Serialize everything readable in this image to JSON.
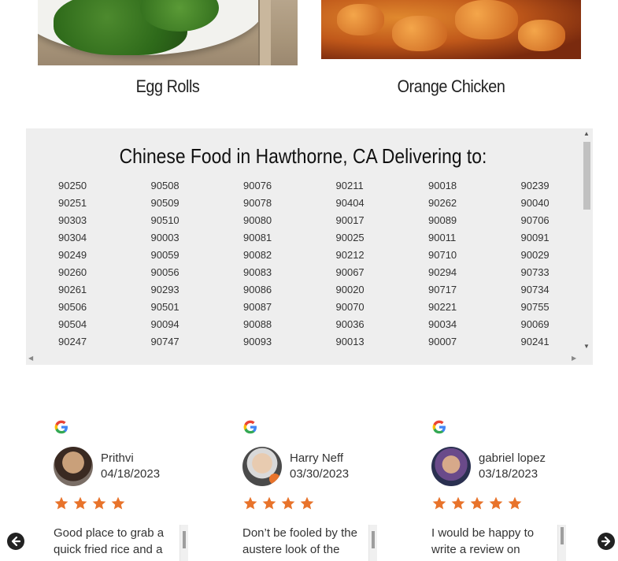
{
  "foods": [
    {
      "title": "Egg Rolls"
    },
    {
      "title": "Orange Chicken"
    }
  ],
  "delivery": {
    "heading": "Chinese Food in Hawthorne, CA Delivering to:",
    "zips": [
      "90250",
      "90508",
      "90076",
      "90211",
      "90018",
      "90239",
      "90251",
      "90509",
      "90078",
      "90404",
      "90262",
      "90040",
      "90303",
      "90510",
      "90080",
      "90017",
      "90089",
      "90706",
      "90304",
      "90003",
      "90081",
      "90025",
      "90011",
      "90091",
      "90249",
      "90059",
      "90082",
      "90212",
      "90710",
      "90029",
      "90260",
      "90056",
      "90083",
      "90067",
      "90294",
      "90733",
      "90261",
      "90293",
      "90086",
      "90020",
      "90717",
      "90734",
      "90506",
      "90501",
      "90087",
      "90070",
      "90221",
      "90755",
      "90504",
      "90094",
      "90088",
      "90036",
      "90034",
      "90069",
      "90247",
      "90747",
      "90093",
      "90013",
      "90007",
      "90241"
    ]
  },
  "reviews": [
    {
      "name": "Prithvi",
      "date": "04/18/2023",
      "stars": 4,
      "text": "Good place to grab a quick fried rice and a"
    },
    {
      "name": "Harry Neff",
      "date": "03/30/2023",
      "stars": 4,
      "text": "Don’t be fooled by the austere look of the"
    },
    {
      "name": "gabriel lopez",
      "date": "03/18/2023",
      "stars": 5,
      "text": "I would be happy to write a review on"
    }
  ],
  "colors": {
    "star": "#e8732b",
    "panel": "#eeeeee"
  },
  "icons": {
    "prev": "arrow-left-circle-icon",
    "next": "arrow-right-circle-icon",
    "source": "google-g-icon"
  }
}
